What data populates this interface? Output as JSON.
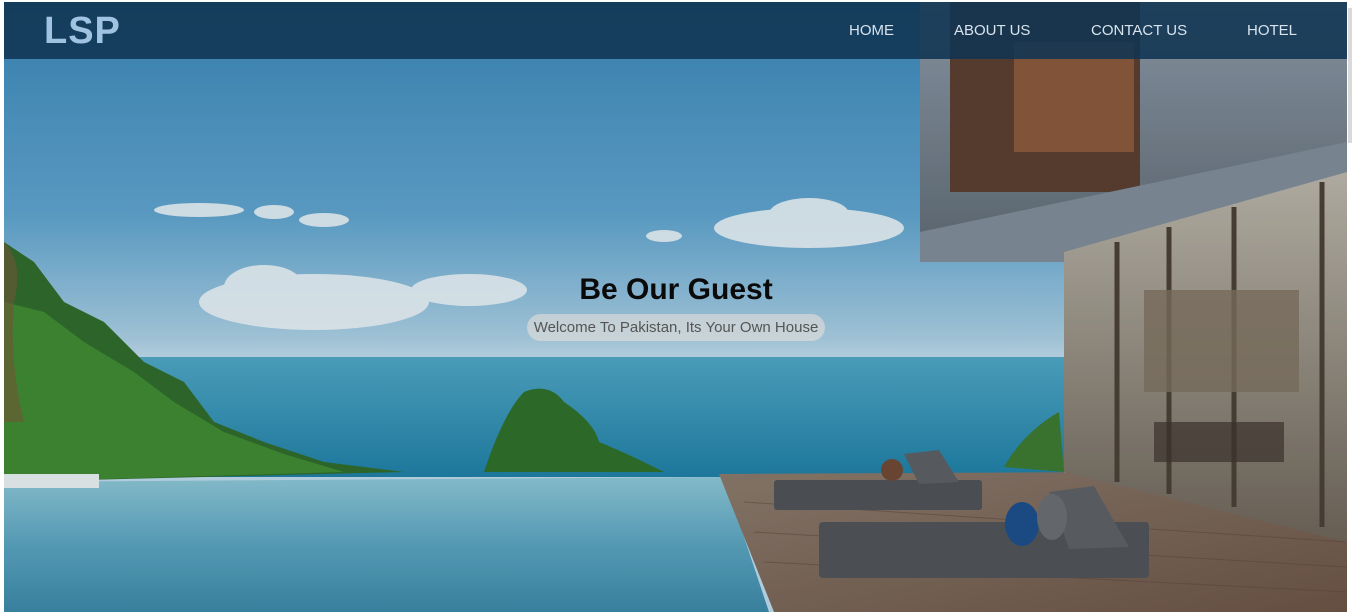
{
  "brand": {
    "logo_text": "LSP"
  },
  "nav": {
    "home": "HOME",
    "about": "ABOUT US",
    "contact": "CONTACT US",
    "hotel": "HOTEL"
  },
  "hero": {
    "title": "Be Our Guest",
    "subtitle": "Welcome To Pakistan, Its Your Own House"
  },
  "colors": {
    "navbar": "#103452",
    "logo": "#9fc3e0",
    "nav_text": "#d8e3ec"
  }
}
